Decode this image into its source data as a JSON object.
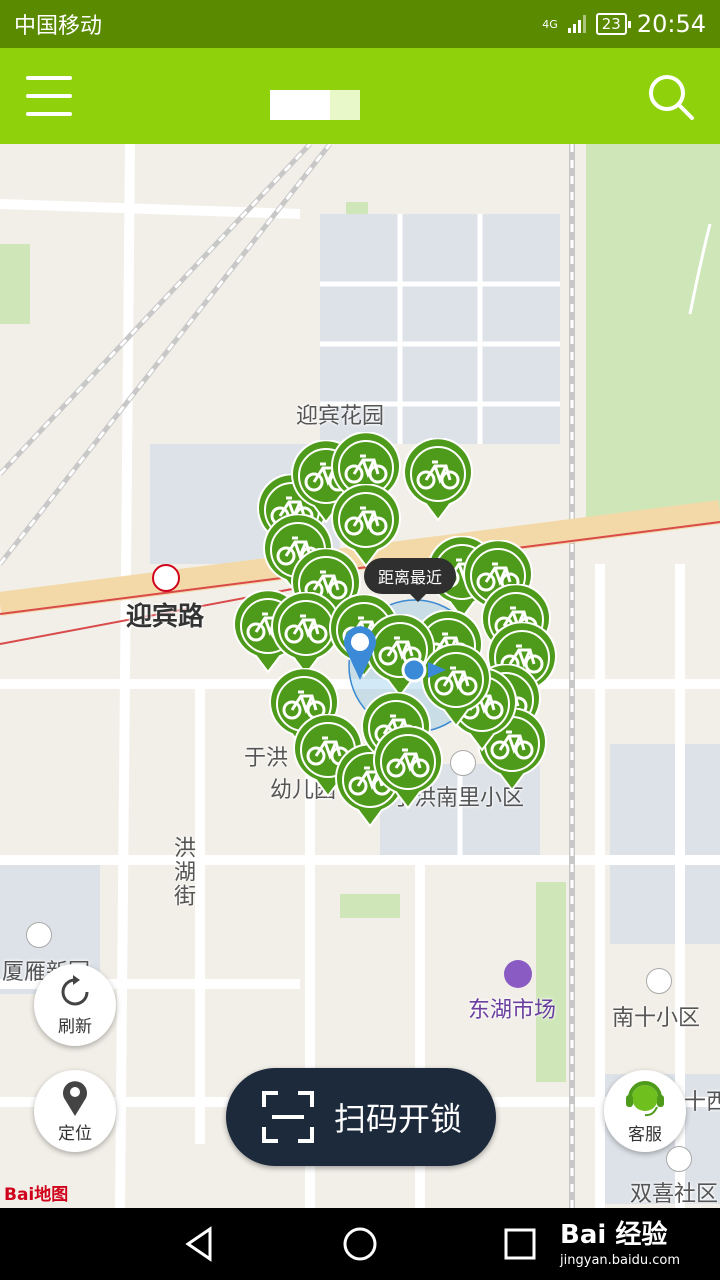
{
  "status_bar": {
    "carrier": "中国移动",
    "network": "4G",
    "battery": "23",
    "time": "20:54"
  },
  "header": {
    "title": ""
  },
  "map": {
    "labels": {
      "yingbin_garden": "迎宾花园",
      "yingbin_road": "迎宾路",
      "yuhong_kindergarten_1": "于洪",
      "yuhong_kindergarten_2": "幼儿园",
      "yuhong_nanli": "于洪南里小区",
      "honghu_street": "洪湖街",
      "xiayan": "厦雁新园",
      "donghu_market": "东湖市场",
      "nanshi_district": "南十小区",
      "shixi": "十西",
      "shuangxi": "双喜社区"
    },
    "tooltip": "距离最近",
    "logo": "Bai地图"
  },
  "buttons": {
    "refresh": "刷新",
    "locate": "定位",
    "scan_unlock": "扫码开锁",
    "customer_service": "客服"
  },
  "watermark": {
    "main": "Bai 经验",
    "sub": "jingyan.baidu.com"
  },
  "colors": {
    "header": "#8fd10a",
    "status_bar": "#5a8a00",
    "bike_pin": "#4e9a1a",
    "scan_button": "#1c2a3c"
  }
}
